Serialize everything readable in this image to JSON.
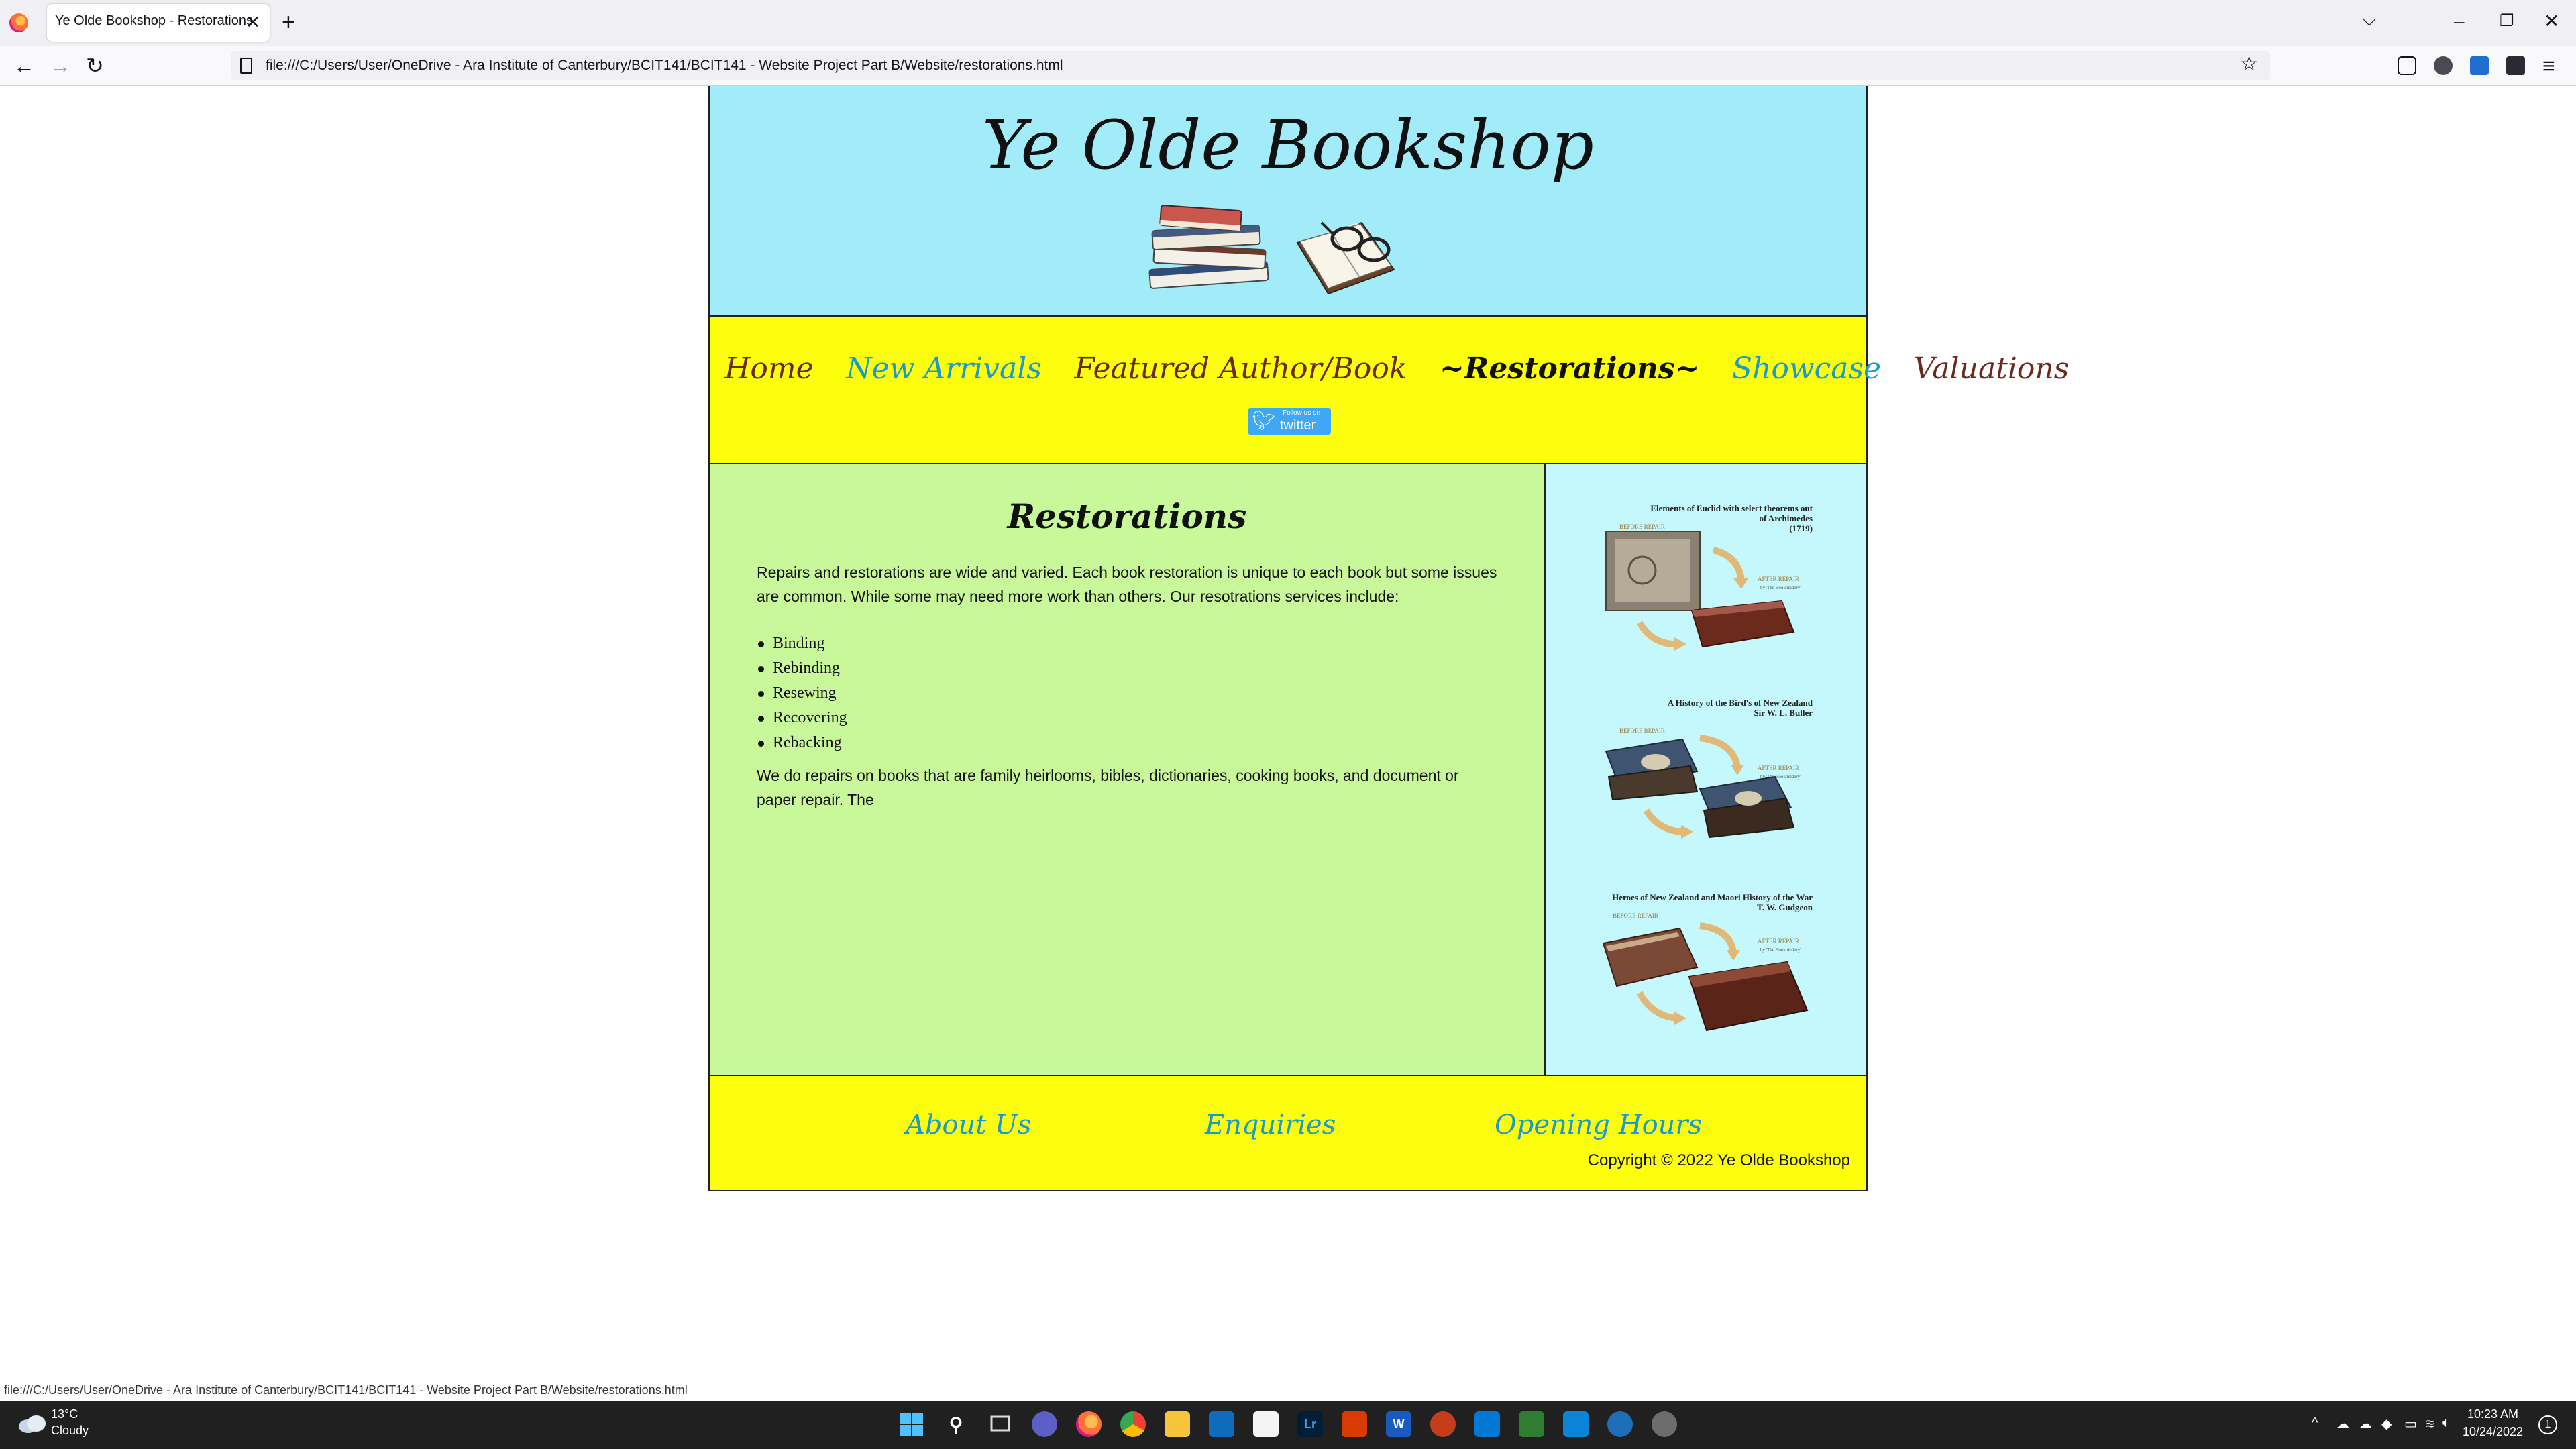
{
  "browser": {
    "tab_title": "Ye Olde Bookshop - Restorations",
    "tab_close": "✕",
    "new_tab": "+",
    "url": "file:///C:/Users/User/OneDrive - Ara Institute of Canterbury/BCIT141/BCIT141 - Website Project Part B/Website/restorations.html",
    "status_url": "file:///C:/Users/User/OneDrive - Ara Institute of Canterbury/BCIT141/BCIT141 - Website Project Part B/Website/restorations.html"
  },
  "site": {
    "title": "Ye Olde Bookshop",
    "nav": [
      "Home",
      "New Arrivals",
      "Featured Author/Book",
      "~Restorations~",
      "Showcase",
      "Valuations"
    ],
    "twitter": {
      "small": "Follow us on",
      "label": "twitter"
    }
  },
  "content": {
    "title": "Restorations",
    "intro": "Repairs and restorations are wide and varied. Each book restoration is unique to each book but some issues are common. While some may need more work than others. Our resotrations services include:",
    "services": [
      "Binding",
      "Rebinding",
      "Resewing",
      "Recovering",
      "Rebacking"
    ],
    "outro": "We do repairs on books that are family heirlooms, bibles, dictionaries, cooking books, and document or paper repair. The"
  },
  "sidebar": {
    "cards": [
      {
        "title": "Elements of Euclid with select theorems out of Archimedes",
        "subtitle": "(1719)",
        "before": "BEFORE REPAIR",
        "after": "AFTER REPAIR",
        "by": "by 'The Bookbindery'"
      },
      {
        "title": "A History of the Bird's of New Zealand",
        "subtitle": "Sir W. L. Buller",
        "before": "BEFORE REPAIR",
        "after": "AFTER REPAIR",
        "by": "by 'The Bookbindery'"
      },
      {
        "title": "Heroes of New Zealand and Maori History of the War",
        "subtitle": "T. W. Gudgeon",
        "before": "BEFORE REPAIR",
        "after": "AFTER REPAIR",
        "by": "by 'The Bookbindery'"
      }
    ]
  },
  "footer": {
    "links": [
      "About Us",
      "Enquiries",
      "Opening Hours"
    ],
    "copyright": "Copyright © 2022 Ye Olde Bookshop"
  },
  "taskbar": {
    "weather_temp": "13°C",
    "weather_cond": "Cloudy",
    "time": "10:23 AM",
    "date": "10/24/2022",
    "notification_count": "1"
  }
}
